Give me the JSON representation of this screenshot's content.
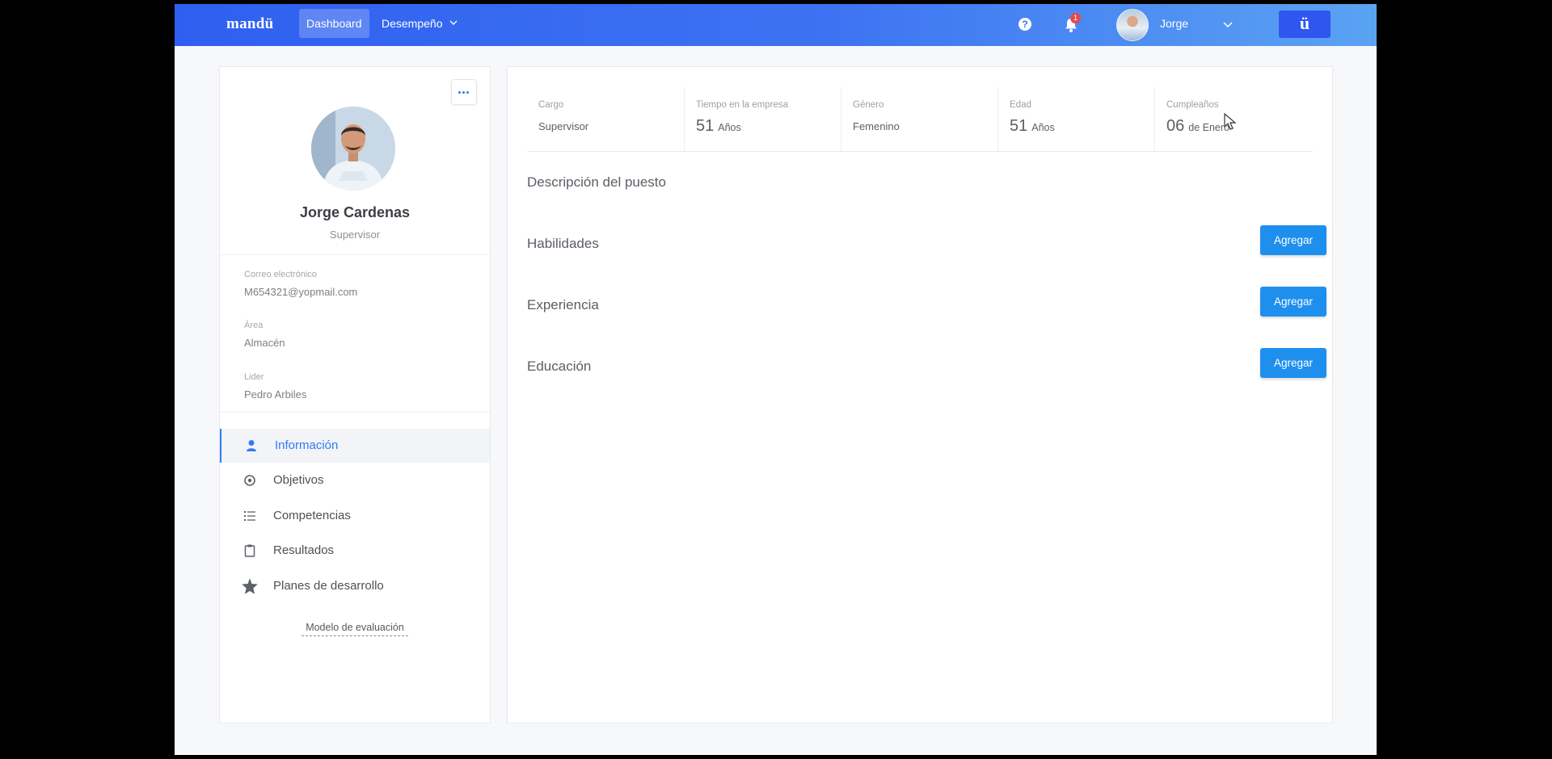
{
  "header": {
    "logo": "mandü",
    "nav": {
      "dashboard": "Dashboard",
      "desempeno": "Desempeño"
    },
    "notifications_count": "1",
    "help_glyph": "?",
    "user_name": "Jorge",
    "brand_button": "ü"
  },
  "profile": {
    "name": "Jorge Cardenas",
    "role": "Supervisor",
    "fields": [
      {
        "label": "Correo electrónico",
        "value": "M654321@yopmail.com"
      },
      {
        "label": "Área",
        "value": "Almacén"
      },
      {
        "label": "Lider",
        "value": "Pedro Arbiles"
      }
    ],
    "menu": [
      {
        "label": "Información",
        "icon": "user-icon",
        "active": true
      },
      {
        "label": "Objetivos",
        "icon": "target-icon"
      },
      {
        "label": "Competencias",
        "icon": "list-icon"
      },
      {
        "label": "Resultados",
        "icon": "clipboard-icon"
      },
      {
        "label": "Planes de desarrollo",
        "icon": "star-badge-icon"
      }
    ],
    "model_link": "Modelo de evaluación"
  },
  "stats": {
    "cargo": {
      "label": "Cargo",
      "value": "Supervisor"
    },
    "tiempo": {
      "label": "Tiempo en la empresa",
      "value": "51",
      "unit": "Años"
    },
    "genero": {
      "label": "Género",
      "value": "Femenino"
    },
    "edad": {
      "label": "Edad",
      "value": "51",
      "unit": "Años"
    },
    "cumple": {
      "label": "Cumpleaños",
      "value": "06",
      "unit": "de Enero"
    }
  },
  "sections": {
    "descripcion": "Descripción del puesto",
    "habilidades": "Habilidades",
    "experiencia": "Experiencia",
    "educacion": "Educación",
    "add_label": "Agregar"
  },
  "colors": {
    "primary": "#1f8fee",
    "header_start": "#2f5ff0",
    "header_end": "#5aa3f2",
    "badge": "#e64a4a"
  }
}
